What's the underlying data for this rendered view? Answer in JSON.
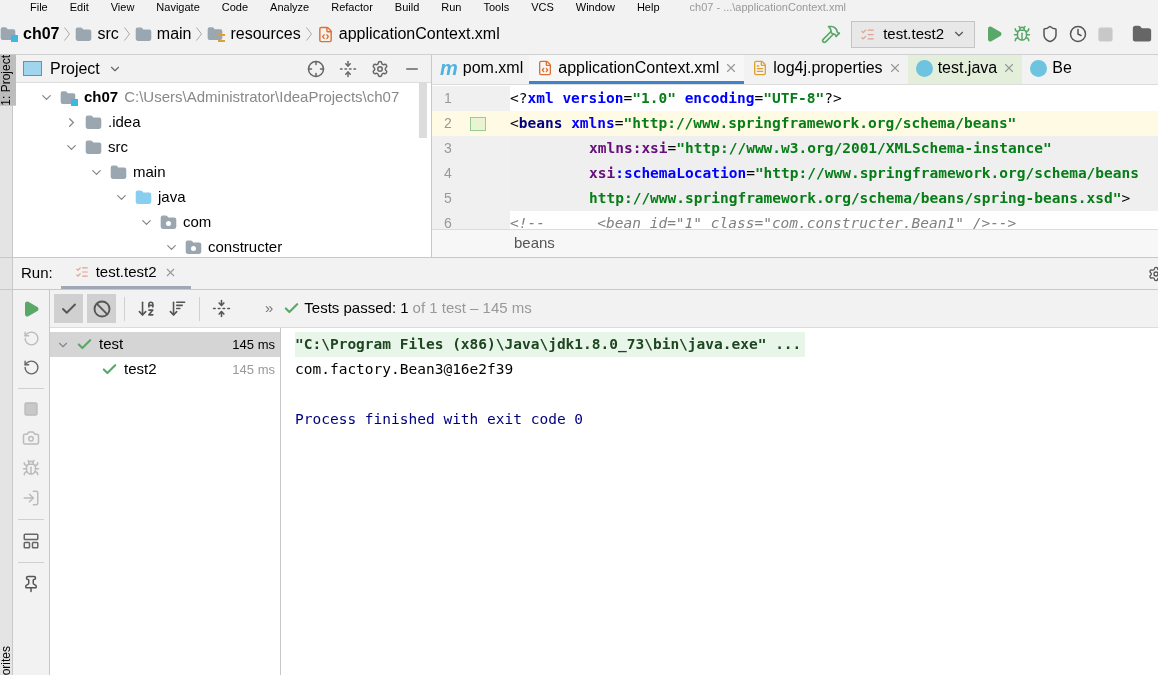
{
  "menu": {
    "items": [
      "File",
      "Edit",
      "View",
      "Navigate",
      "Code",
      "Analyze",
      "Refactor",
      "Build",
      "Run",
      "Tools",
      "VCS",
      "Window",
      "Help"
    ],
    "title": "ch07 - ...\\applicationContext.xml"
  },
  "breadcrumb": [
    {
      "label": "ch07",
      "kind": "module"
    },
    {
      "label": "src",
      "kind": "folder"
    },
    {
      "label": "main",
      "kind": "folder"
    },
    {
      "label": "resources",
      "kind": "resources"
    },
    {
      "label": "applicationContext.xml",
      "kind": "xml"
    }
  ],
  "run_config": "test.test2",
  "side_labels": {
    "top": "1: Project",
    "bottom": "orites"
  },
  "project": {
    "title": "Project",
    "tree": [
      {
        "label": "ch07",
        "path": "C:\\Users\\Administrator\\IdeaProjects\\ch07",
        "kind": "module",
        "expanded": true,
        "children": [
          {
            "label": ".idea",
            "kind": "folder",
            "expanded": false
          },
          {
            "label": "src",
            "kind": "folder",
            "expanded": true,
            "children": [
              {
                "label": "main",
                "kind": "folder",
                "expanded": true,
                "children": [
                  {
                    "label": "java",
                    "kind": "source",
                    "expanded": true,
                    "children": [
                      {
                        "label": "com",
                        "kind": "package",
                        "expanded": true,
                        "children": [
                          {
                            "label": "constructer",
                            "kind": "package",
                            "expanded": true
                          }
                        ]
                      }
                    ]
                  }
                ]
              }
            ]
          }
        ]
      }
    ]
  },
  "editor": {
    "tabs": [
      {
        "label": "pom.xml",
        "kind": "maven",
        "icon_text": "m",
        "selected": false,
        "test": false,
        "closable": false
      },
      {
        "label": "applicationContext.xml",
        "kind": "xml",
        "selected": true,
        "test": false,
        "closable": true
      },
      {
        "label": "log4j.properties",
        "kind": "properties",
        "selected": false,
        "test": false,
        "closable": true
      },
      {
        "label": "test.java",
        "kind": "class",
        "selected": false,
        "test": true,
        "closable": true
      },
      {
        "label": "Be",
        "kind": "class",
        "selected": false,
        "test": false,
        "closable": false
      }
    ],
    "lines": [
      {
        "number": "1",
        "kind": "plain",
        "segments": [
          {
            "kind": "punct",
            "text": "<?"
          },
          {
            "kind": "attr",
            "text": "xml version"
          },
          {
            "kind": "punct",
            "text": "="
          },
          {
            "kind": "value",
            "text": "\"1.0\" "
          },
          {
            "kind": "attr",
            "text": "encoding"
          },
          {
            "kind": "punct",
            "text": "="
          },
          {
            "kind": "value",
            "text": "\"UTF-8\""
          },
          {
            "kind": "punct",
            "text": "?>"
          }
        ]
      },
      {
        "number": "2",
        "kind": "caret",
        "segments": [
          {
            "kind": "punct",
            "text": "<"
          },
          {
            "kind": "tag",
            "text": "beans "
          },
          {
            "kind": "attr",
            "text": "xmlns"
          },
          {
            "kind": "punct",
            "text": "="
          },
          {
            "kind": "value",
            "text": "\"http://www.springframework.org/schema/beans\""
          }
        ]
      },
      {
        "number": "3",
        "kind": "continuation",
        "segments": [
          {
            "kind": "ns",
            "text": "xmlns:xsi"
          },
          {
            "kind": "punct",
            "text": "="
          },
          {
            "kind": "value",
            "text": "\"http://www.w3.org/2001/XMLSchema-instance\""
          }
        ]
      },
      {
        "number": "4",
        "kind": "continuation",
        "segments": [
          {
            "kind": "ns",
            "text": "xsi"
          },
          {
            "kind": "attr",
            "text": ":schemaLocation"
          },
          {
            "kind": "punct",
            "text": "="
          },
          {
            "kind": "value",
            "text": "\"http://www.springframework.org/schema/beans"
          }
        ]
      },
      {
        "number": "5",
        "kind": "continuation",
        "segments": [
          {
            "kind": "value",
            "text": "http://www.springframework.org/schema/beans/spring-beans.xsd\""
          },
          {
            "kind": "punct",
            "text": ">"
          }
        ]
      },
      {
        "number": "6",
        "kind": "plain",
        "segments": [
          {
            "kind": "comment",
            "text": "<!--      <bean id=\"1\" class=\"com.constructer.Bean1\" />-->"
          }
        ]
      }
    ],
    "path": "beans"
  },
  "run": {
    "label": "Run:",
    "tab": {
      "label": "test.test2",
      "selected": true
    },
    "toggles": [
      {
        "kind": "passed",
        "selected": true
      },
      {
        "kind": "ignored",
        "selected": true
      }
    ],
    "more": "»",
    "status": "Tests passed: 1",
    "status_detail": "of 1 test – 145 ms",
    "tests": [
      {
        "label": "test",
        "time": "145 ms",
        "selected": true,
        "expanded": true,
        "children": [
          {
            "label": "test2",
            "time": "145 ms",
            "selected": false
          }
        ]
      }
    ],
    "console": [
      {
        "kind": "command",
        "text": "\"C:\\Program Files (x86)\\Java\\jdk1.8.0_73\\bin\\java.exe\" ..."
      },
      {
        "kind": "output",
        "text": "com.factory.Bean3@16e2f39"
      },
      {
        "kind": "blank"
      },
      {
        "kind": "system",
        "text": "Process finished with exit code 0"
      }
    ]
  }
}
